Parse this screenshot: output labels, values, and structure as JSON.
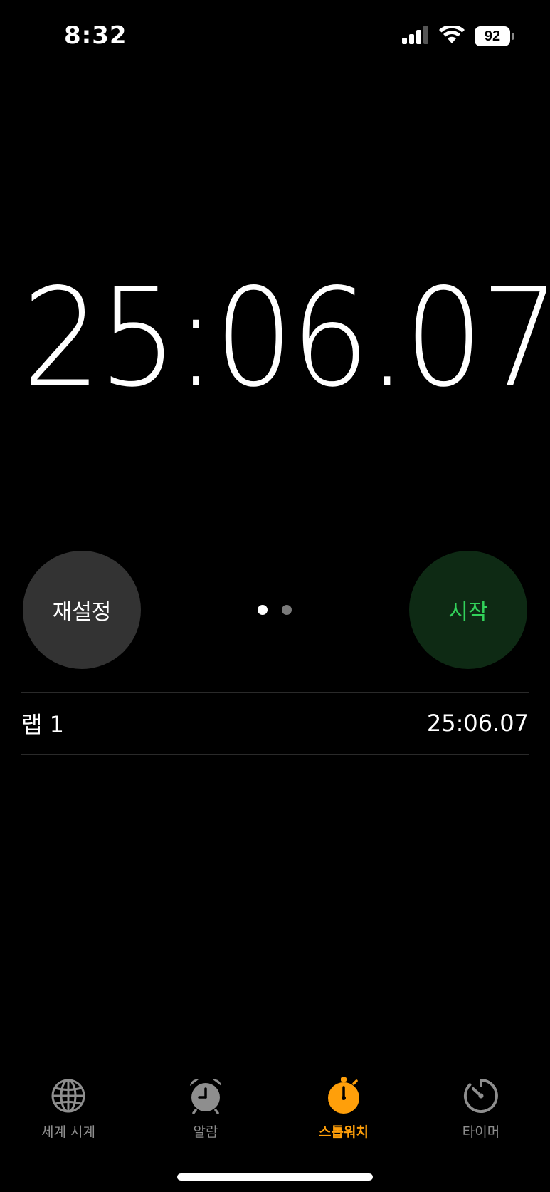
{
  "status_bar": {
    "time": "8:32",
    "battery_level": "92",
    "signal_icon": "cellular-signal-icon",
    "wifi_icon": "wifi-icon"
  },
  "stopwatch": {
    "elapsed": "25:06.07"
  },
  "controls": {
    "reset_label": "재설정",
    "start_label": "시작",
    "page_count": 2,
    "active_page": 1
  },
  "laps": [
    {
      "label": "랩 1",
      "time": "25:06.07"
    }
  ],
  "tabs": [
    {
      "label": "세계 시계",
      "icon": "globe-icon",
      "active": false
    },
    {
      "label": "알람",
      "icon": "alarm-clock-icon",
      "active": false
    },
    {
      "label": "스톱워치",
      "icon": "stopwatch-icon",
      "active": true
    },
    {
      "label": "타이머",
      "icon": "timer-icon",
      "active": false
    }
  ],
  "colors": {
    "background": "#000000",
    "accent": "#ff9f0a",
    "start_green": "#32d25a",
    "start_bg": "#0e2a14",
    "reset_bg": "#333333",
    "inactive_tab": "#8e8e8e"
  }
}
